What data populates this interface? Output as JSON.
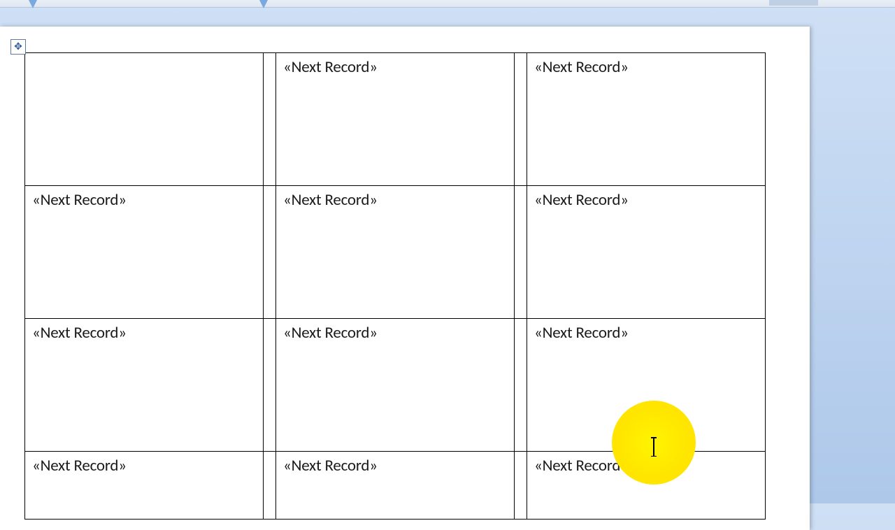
{
  "merge_field": "«Next Record»",
  "grid": {
    "rows": 4,
    "cols": 3,
    "cells": [
      [
        "",
        "«Next Record»",
        "«Next Record»"
      ],
      [
        "«Next Record»",
        "«Next Record»",
        "«Next Record»"
      ],
      [
        "«Next Record»",
        "«Next Record»",
        "«Next Record»"
      ],
      [
        "«Next Record»",
        "«Next Record»",
        "«Next Record»"
      ]
    ]
  },
  "handle": {
    "tooltip": "Move table"
  },
  "cursor_position": {
    "row": 3,
    "col": 2
  }
}
